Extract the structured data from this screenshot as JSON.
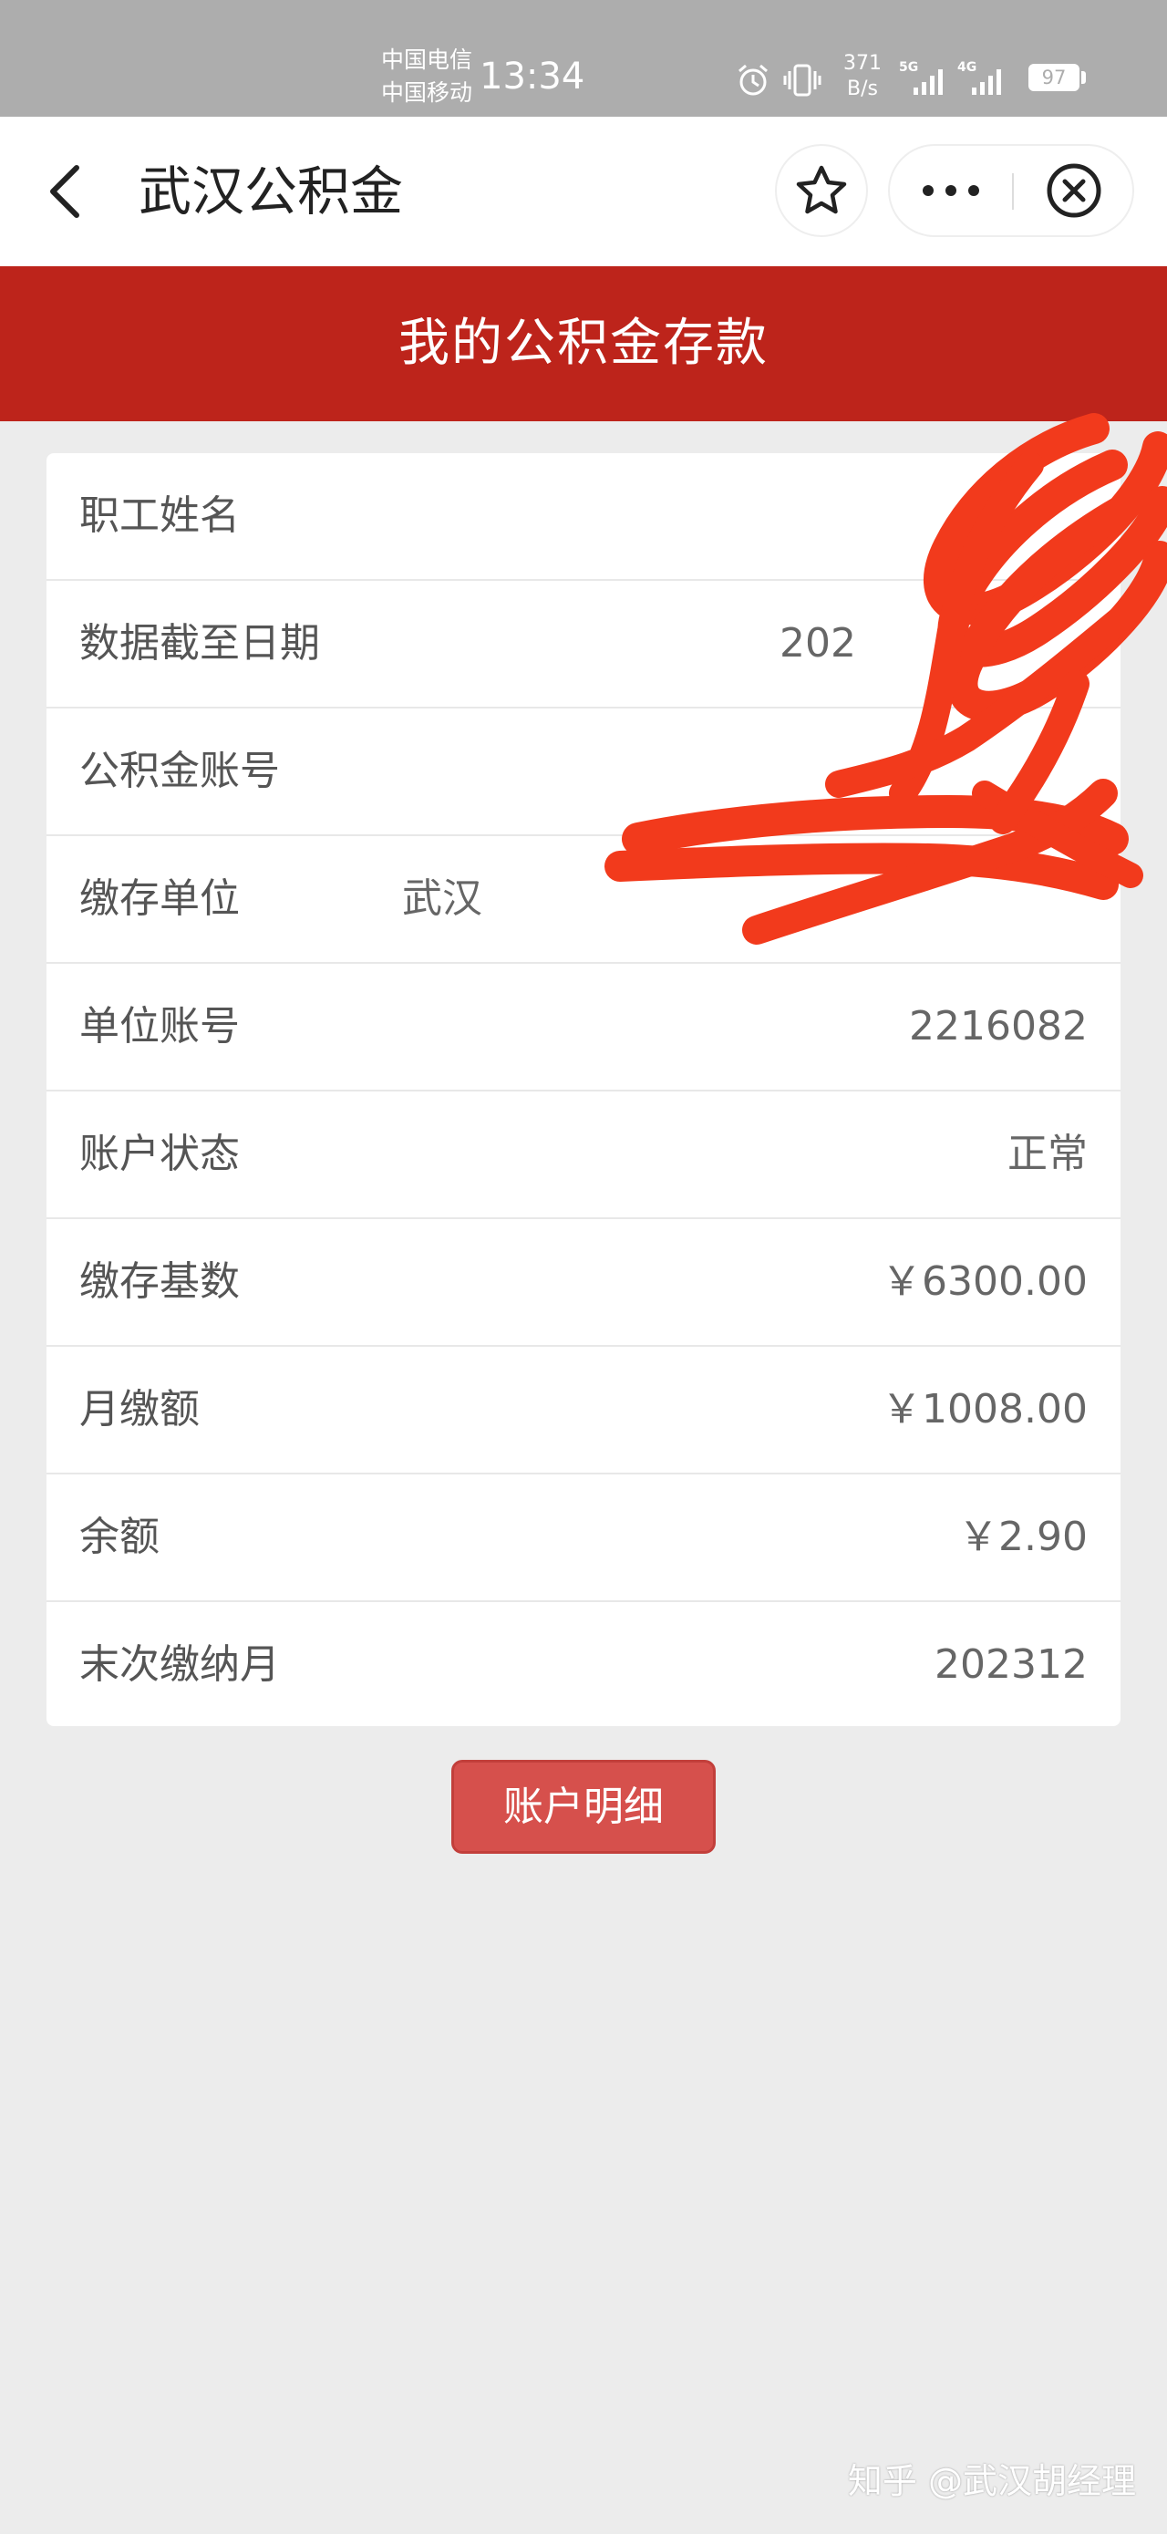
{
  "status_bar": {
    "carrier_1": "中国电信",
    "carrier_2": "中国移动",
    "time": "13:34",
    "speed_value": "371",
    "speed_unit": "B/s",
    "net_1": "5G",
    "net_2": "4G",
    "battery": "97",
    "icons": [
      "alarm-icon",
      "vibrate-icon",
      "signal-icon",
      "battery-icon"
    ]
  },
  "nav": {
    "title": "武汉公积金",
    "icons": [
      "back-arrow-icon",
      "star-icon",
      "more-dots-icon",
      "close-circle-icon"
    ]
  },
  "header": {
    "title": "我的公积金存款",
    "color": "#bd241b"
  },
  "info_rows": [
    {
      "label": "职工姓名",
      "value": ""
    },
    {
      "label": "数据截至日期",
      "value": "202"
    },
    {
      "label": "公积金账号",
      "value": ""
    },
    {
      "label": "缴存单位",
      "value": "武汉"
    },
    {
      "label": "单位账号",
      "value": "2216082"
    },
    {
      "label": "账户状态",
      "value": "正常"
    },
    {
      "label": "缴存基数",
      "value": "￥6300.00"
    },
    {
      "label": "月缴额",
      "value": "￥1008.00"
    },
    {
      "label": "余额",
      "value": "￥2.90"
    },
    {
      "label": "末次缴纳月",
      "value": "202312"
    }
  ],
  "actions": {
    "detail_label": "账户明细",
    "button_color": "#d6504c"
  },
  "watermark": "知乎 @武汉胡经理"
}
